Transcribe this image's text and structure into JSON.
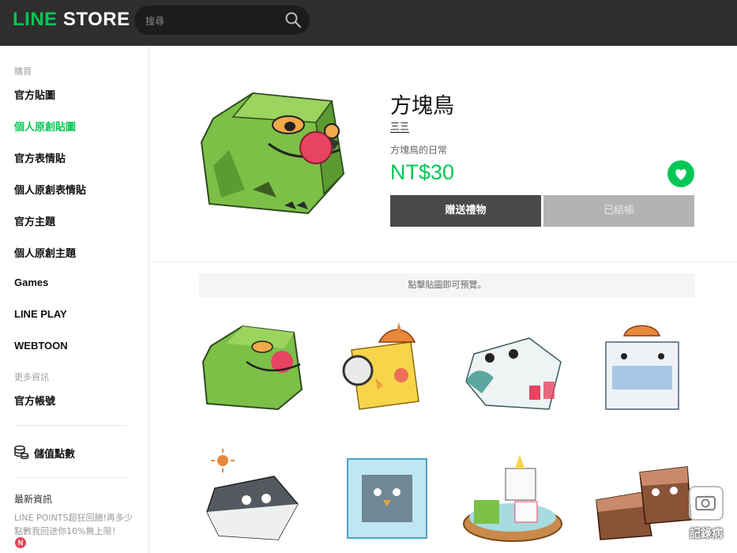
{
  "header": {
    "logo_line": "LINE",
    "logo_store": "STORE",
    "search_placeholder": "搜尋"
  },
  "sidebar": {
    "buy_heading": "購買",
    "items": [
      {
        "label": "官方貼圖",
        "active": false
      },
      {
        "label": "個人原創貼圖",
        "active": true
      },
      {
        "label": "官方表情貼",
        "active": false
      },
      {
        "label": "個人原創表情貼",
        "active": false
      },
      {
        "label": "官方主題",
        "active": false
      },
      {
        "label": "個人原創主題",
        "active": false
      },
      {
        "label": "Games",
        "active": false
      },
      {
        "label": "LINE PLAY",
        "active": false
      },
      {
        "label": "WEBTOON",
        "active": false
      }
    ],
    "more_heading": "更多資訊",
    "official_account": "官方帳號",
    "points_label": "儲值點數",
    "news_heading": "最新資訊",
    "news_text": "LINE POINTS超狂回饋!再多少點數我回送你10%無上限！",
    "news_badge": "N"
  },
  "product": {
    "title": "方塊鳥",
    "author": "三三",
    "description": "方塊鳥的日常",
    "price": "NT$30",
    "gift_button": "贈送禮物",
    "purchased_button": "已結帳",
    "preview_hint": "點擊貼圖即可預覽。"
  },
  "stickers": [
    {
      "name": "green-bird"
    },
    {
      "name": "yellow-detective-bird"
    },
    {
      "name": "white-bird-drink"
    },
    {
      "name": "bird-with-mask"
    },
    {
      "name": "grey-bird-sun"
    },
    {
      "name": "frozen-bird"
    },
    {
      "name": "birds-in-bowl"
    },
    {
      "name": "brown-birds"
    }
  ],
  "overlay": {
    "camera_label": "記錄病"
  },
  "colors": {
    "brand_green": "#06c755",
    "header_bg": "#2e2e2e",
    "gift_button_bg": "#4a4a4a",
    "disabled_button_bg": "#b3b3b3"
  }
}
